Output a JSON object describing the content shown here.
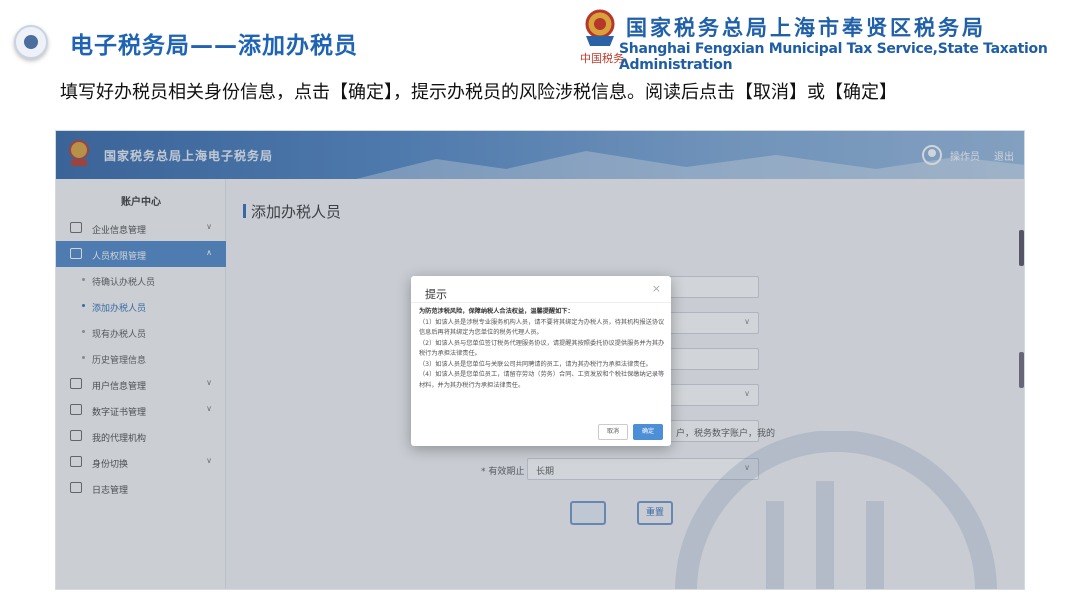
{
  "slide": {
    "title": "电子税务局——添加办税员",
    "logo_cn": "国家税务总局上海市奉贤区税务局",
    "logo_en": "Shanghai Fengxian Municipal Tax Service,State Taxation  Administration",
    "logo_seal": "中国税务",
    "instruction": "填写好办税员相关身份信息，点击【确定】，提示办税员的风险涉税信息。阅读后点击【取消】或【确定】"
  },
  "app": {
    "title": "国家税务总局上海电子税务局",
    "user_name": "操作员",
    "logout": "退出"
  },
  "sidebar": {
    "heading": "账户中心",
    "items": [
      {
        "label": "企业信息管理",
        "icon": "building-icon"
      },
      {
        "label": "人员权限管理",
        "icon": "people-icon",
        "active": true
      },
      {
        "label": "用户信息管理",
        "icon": "user-card-icon"
      },
      {
        "label": "数字证书管理",
        "icon": "certificate-icon"
      },
      {
        "label": "我的代理机构",
        "icon": "agency-icon"
      },
      {
        "label": "身份切换",
        "icon": "switch-icon"
      },
      {
        "label": "日志管理",
        "icon": "log-icon"
      }
    ],
    "sub_items": [
      {
        "label": "待确认办税人员"
      },
      {
        "label": "添加办税人员",
        "current": true
      },
      {
        "label": "现有办税人员"
      },
      {
        "label": "历史管理信息"
      }
    ]
  },
  "main": {
    "page_title": "添加办税人员",
    "field_text": "户，税务数字账户，我的",
    "expire_label": "* 有效期止",
    "expire_value": "长期",
    "save_button": "重置"
  },
  "dialog": {
    "title": "提示",
    "close": "×",
    "lead": "为防范涉税风险，保障纳税人合法权益，温馨提醒如下：",
    "p1": "（1）如该人员是涉税专业服务机构人员，请不要将其绑定为办税人员，待其机构报送协议信息后再将其绑定为您单位的税务代理人员。",
    "p2": "（2）如该人员与您单位签订税务代理服务协议，请提醒其按照委托协议提供服务并为其办税行为承担法律责任。",
    "p3": "（3）如该人员是您单位与关联公司共同聘请的员工，请为其办税行为承担法律责任。",
    "p4": "（4）如该人员是您单位员工，请留存劳动（劳务）合同、工资发放和个税社保缴纳记录等材料，并为其办税行为承担法律责任。",
    "cancel": "取消",
    "ok": "确定"
  },
  "colors": {
    "title_blue": "#1f64b4",
    "active_nav": "#4a86c8",
    "ok_button": "#4d8fd6"
  }
}
